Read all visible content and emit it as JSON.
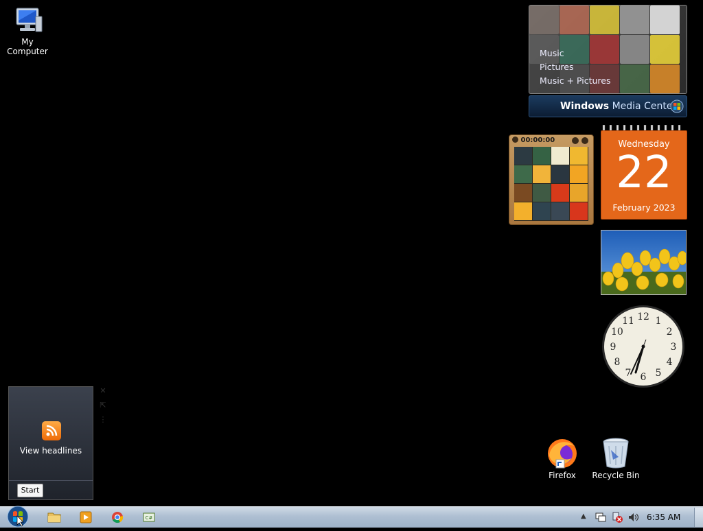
{
  "desktop": {
    "icons": {
      "my_computer": "My Computer",
      "firefox": "Firefox",
      "recycle_bin": "Recycle Bin"
    }
  },
  "gadgets": {
    "media_center": {
      "menu": [
        "Music",
        "Pictures",
        "Music + Pictures"
      ],
      "brand_bold": "Windows",
      "brand_rest": " Media Center"
    },
    "puzzle": {
      "timer": "00:00:00"
    },
    "calendar": {
      "weekday": "Wednesday",
      "day": "22",
      "month_year": "February 2023"
    },
    "clock": {
      "hour_numerals": [
        "12",
        "1",
        "2",
        "3",
        "4",
        "5",
        "6",
        "7",
        "8",
        "9",
        "10",
        "11"
      ]
    },
    "feed": {
      "view_label": "View headlines",
      "start_label": "Start"
    }
  },
  "taskbar": {
    "time": "6:35 AM",
    "pinned": [
      "file-explorer-icon",
      "media-player-icon",
      "chrome-icon",
      "csharp-app-icon"
    ]
  },
  "colors": {
    "calendar_orange": "#e4671a",
    "taskbar": "#aebfd2",
    "rss_orange": "#f07f1a"
  }
}
